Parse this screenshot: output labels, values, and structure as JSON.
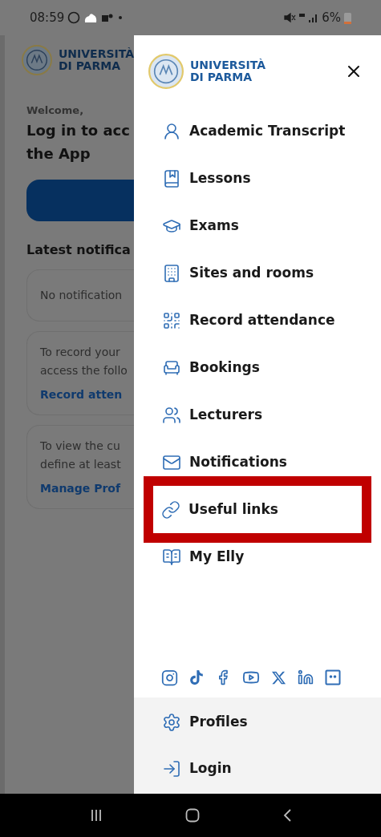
{
  "status_bar": {
    "time": "08:59",
    "battery": "6%"
  },
  "background_app": {
    "logo": {
      "line1": "UNIVERSITÀ",
      "line2": "DI PARMA"
    },
    "greeting": "Welcome,",
    "heading_lines": [
      "Log in to acc",
      "the App"
    ],
    "section_title": "Latest notifica",
    "cards": [
      {
        "lines": [
          "No notification"
        ]
      },
      {
        "lines": [
          "To record your",
          "access the follo"
        ],
        "link": "Record atten"
      },
      {
        "lines": [
          "To view the cu",
          "define at least"
        ],
        "link": "Manage Prof"
      }
    ]
  },
  "drawer": {
    "logo": {
      "line1": "UNIVERSITÀ",
      "line2": "DI PARMA"
    },
    "items": [
      {
        "label": "Academic Transcript",
        "highlighted": false
      },
      {
        "label": "Lessons",
        "highlighted": false
      },
      {
        "label": "Exams",
        "highlighted": false
      },
      {
        "label": "Sites and rooms",
        "highlighted": false
      },
      {
        "label": "Record attendance",
        "highlighted": false
      },
      {
        "label": "Bookings",
        "highlighted": false
      },
      {
        "label": "Lecturers",
        "highlighted": false
      },
      {
        "label": "Notifications",
        "highlighted": false
      },
      {
        "label": "Useful links",
        "highlighted": true
      },
      {
        "label": "My Elly",
        "highlighted": false
      }
    ],
    "footer_items": [
      {
        "label": "Profiles"
      },
      {
        "label": "Login"
      }
    ]
  }
}
